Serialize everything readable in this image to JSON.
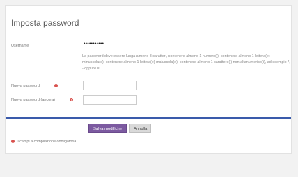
{
  "form": {
    "title": "Imposta password",
    "username_label": "Username",
    "username_value": "•••••••••••",
    "password_hint": "La password deve essere lunga almeno 8 caratteri, contenere almeno 1 numero(i), contenere almeno 1 lettera(e) minuscola(e), contenere almeno 1 lettera(e) maiuscola(e), contenere almeno 1 carattere(i) non alfanumerico(i), ad esempio *, - oppure #.",
    "new_password_label": "Nuova password",
    "new_password_value": "",
    "new_password_again_label": "Nuova password (ancora)",
    "new_password_again_value": "",
    "required_icon": "!",
    "save_label": "Salva modifiche",
    "cancel_label": "Annulla",
    "required_note": "Ii campi a compilazione obbligatoria"
  },
  "colors": {
    "accent": "#3a5bab",
    "primary_button": "#7c5aa0",
    "required": "#d9534f"
  }
}
